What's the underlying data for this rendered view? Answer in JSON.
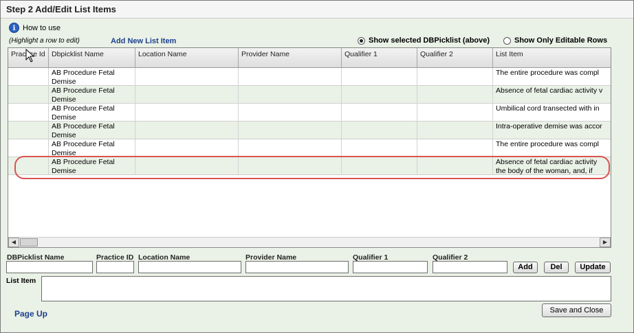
{
  "window": {
    "title": "Step 2 Add/Edit List Items"
  },
  "toolbar": {
    "how_to_use": "How to use",
    "hint": "(Highlight a row to edit)",
    "add_new": "Add New List Item",
    "radio_selected": "Show selected DBPicklist (above)",
    "radio_editable": "Show Only Editable Rows"
  },
  "grid": {
    "columns": [
      "Practice Id",
      "Dbpicklist Name",
      "Location Name",
      "Provider Name",
      "Qualifier 1",
      "Qualifier 2",
      "List Item"
    ],
    "rows": [
      {
        "practice": "",
        "dbpicklist": "AB Procedure Fetal Demise",
        "location": "",
        "provider": "",
        "q1": "",
        "q2": "",
        "item": "The entire procedure was compl"
      },
      {
        "practice": "",
        "dbpicklist": "AB Procedure Fetal Demise",
        "location": "",
        "provider": "",
        "q1": "",
        "q2": "",
        "item": "Absence of fetal cardiac activity v"
      },
      {
        "practice": "",
        "dbpicklist": "AB Procedure Fetal Demise",
        "location": "",
        "provider": "",
        "q1": "",
        "q2": "",
        "item": "Umbilical cord transected with in"
      },
      {
        "practice": "",
        "dbpicklist": "AB Procedure Fetal Demise",
        "location": "",
        "provider": "",
        "q1": "",
        "q2": "",
        "item": "Intra-operative demise was accor"
      },
      {
        "practice": "",
        "dbpicklist": "AB Procedure Fetal Demise",
        "location": "",
        "provider": "",
        "q1": "",
        "q2": "",
        "item": "The entire procedure was compl"
      },
      {
        "practice": "",
        "dbpicklist": "AB Procedure Fetal Demise",
        "location": "",
        "provider": "",
        "q1": "",
        "q2": "",
        "item": "Absence of fetal cardiac activity\nthe body of the woman, and, if"
      }
    ]
  },
  "form": {
    "dbpicklist_label": "DBPicklist Name",
    "practice_label": "Practice ID",
    "location_label": "Location Name",
    "provider_label": "Provider Name",
    "qualifier1_label": "Qualifier 1",
    "qualifier2_label": "Qualifier 2",
    "add": "Add",
    "del": "Del",
    "update": "Update",
    "list_item_label": "List Item"
  },
  "footer": {
    "page_up": "Page Up",
    "save_close": "Save and Close"
  },
  "colors": {
    "accent": "#1c3f8e",
    "row_alt": "#eaf1e6",
    "highlight": "#d9534f"
  }
}
